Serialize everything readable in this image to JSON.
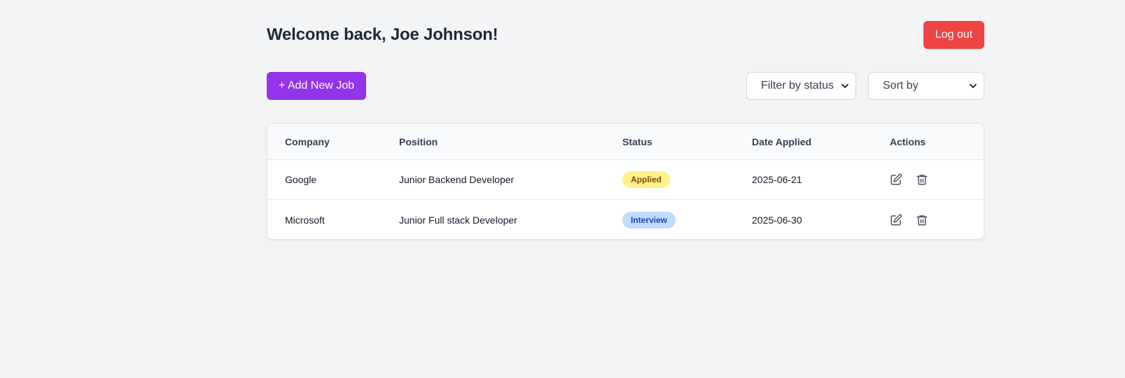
{
  "header": {
    "welcome": "Welcome back, Joe Johnson!",
    "logout_label": "Log out"
  },
  "toolbar": {
    "add_label": "+ Add New Job",
    "filter_status": {
      "selected": "Filter by status"
    },
    "sort": {
      "selected": "Sort by"
    }
  },
  "table": {
    "headers": {
      "company": "Company",
      "position": "Position",
      "status": "Status",
      "date": "Date Applied",
      "actions": "Actions"
    },
    "rows": [
      {
        "company": "Google",
        "position": "Junior Backend Developer",
        "status": "Applied",
        "date": "2025-06-21"
      },
      {
        "company": "Microsoft",
        "position": "Junior Full stack Developer",
        "status": "Interview",
        "date": "2025-06-30"
      }
    ]
  },
  "icons": {
    "edit": "edit-icon",
    "delete": "trash-icon",
    "dropdown": "chevron-down-icon"
  },
  "colors": {
    "background": "#f3f4f6",
    "logout": "#ef4444",
    "add_button": "#9333ea",
    "status_applied_bg": "#fef08a",
    "status_applied_text": "#854d0e",
    "status_interview_bg": "#bfdbfe",
    "status_interview_text": "#1e40af"
  }
}
